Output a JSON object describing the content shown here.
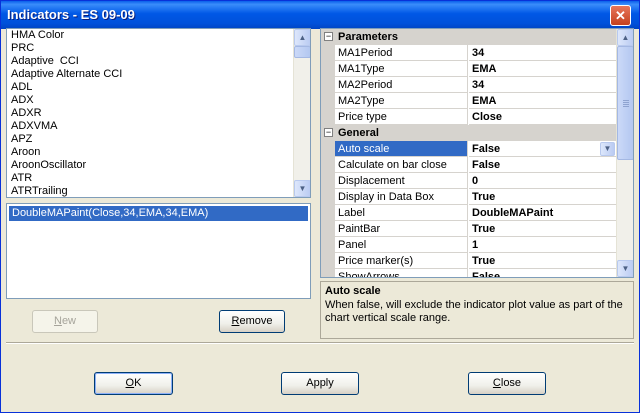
{
  "window": {
    "title": "Indicators - ES 09-09",
    "close_glyph": "✕"
  },
  "indicator_list": {
    "items": [
      "HMA Color",
      "PRC",
      "Adaptive  CCI",
      "Adaptive Alternate CCI",
      "ADL",
      "ADX",
      "ADXR",
      "ADXVMA",
      "APZ",
      "Aroon",
      "AroonOscillator",
      "ATR",
      "ATRTrailing"
    ]
  },
  "selected_list": {
    "items": [
      "DoubleMAPaint(Close,34,EMA,34,EMA)"
    ]
  },
  "buttons": {
    "new": {
      "label": "New",
      "enabled": false
    },
    "remove": {
      "label": "Remove"
    },
    "ok": {
      "label": "OK"
    },
    "apply": {
      "label": "Apply"
    },
    "close": {
      "label": "Close"
    }
  },
  "property_grid": {
    "categories": [
      {
        "label": "Parameters",
        "expander": "−",
        "properties": [
          {
            "name": "MA1Period",
            "value": "34"
          },
          {
            "name": "MA1Type",
            "value": "EMA"
          },
          {
            "name": "MA2Period",
            "value": "34"
          },
          {
            "name": "MA2Type",
            "value": "EMA"
          },
          {
            "name": "Price type",
            "value": "Close"
          }
        ]
      },
      {
        "label": "General",
        "expander": "−",
        "properties": [
          {
            "name": "Auto scale",
            "value": "False",
            "selected": true
          },
          {
            "name": "Calculate on bar close",
            "value": "False"
          },
          {
            "name": "Displacement",
            "value": "0"
          },
          {
            "name": "Display in Data Box",
            "value": "True"
          },
          {
            "name": "Label",
            "value": "DoubleMAPaint"
          },
          {
            "name": "PaintBar",
            "value": "True"
          },
          {
            "name": "Panel",
            "value": "1"
          },
          {
            "name": "Price marker(s)",
            "value": "True"
          },
          {
            "name": "ShowArrows",
            "value": "False"
          }
        ]
      }
    ]
  },
  "help": {
    "title": "Auto scale",
    "text": "When false, will exclude the indicator plot value as part of the chart vertical scale range."
  },
  "colors": {
    "selection": "#316AC5",
    "title_bar": "#0058E6",
    "dialog_bg": "#ECE9D8"
  },
  "icons": {
    "scroll_up": "▲",
    "scroll_down": "▼",
    "dropdown": "▼"
  }
}
